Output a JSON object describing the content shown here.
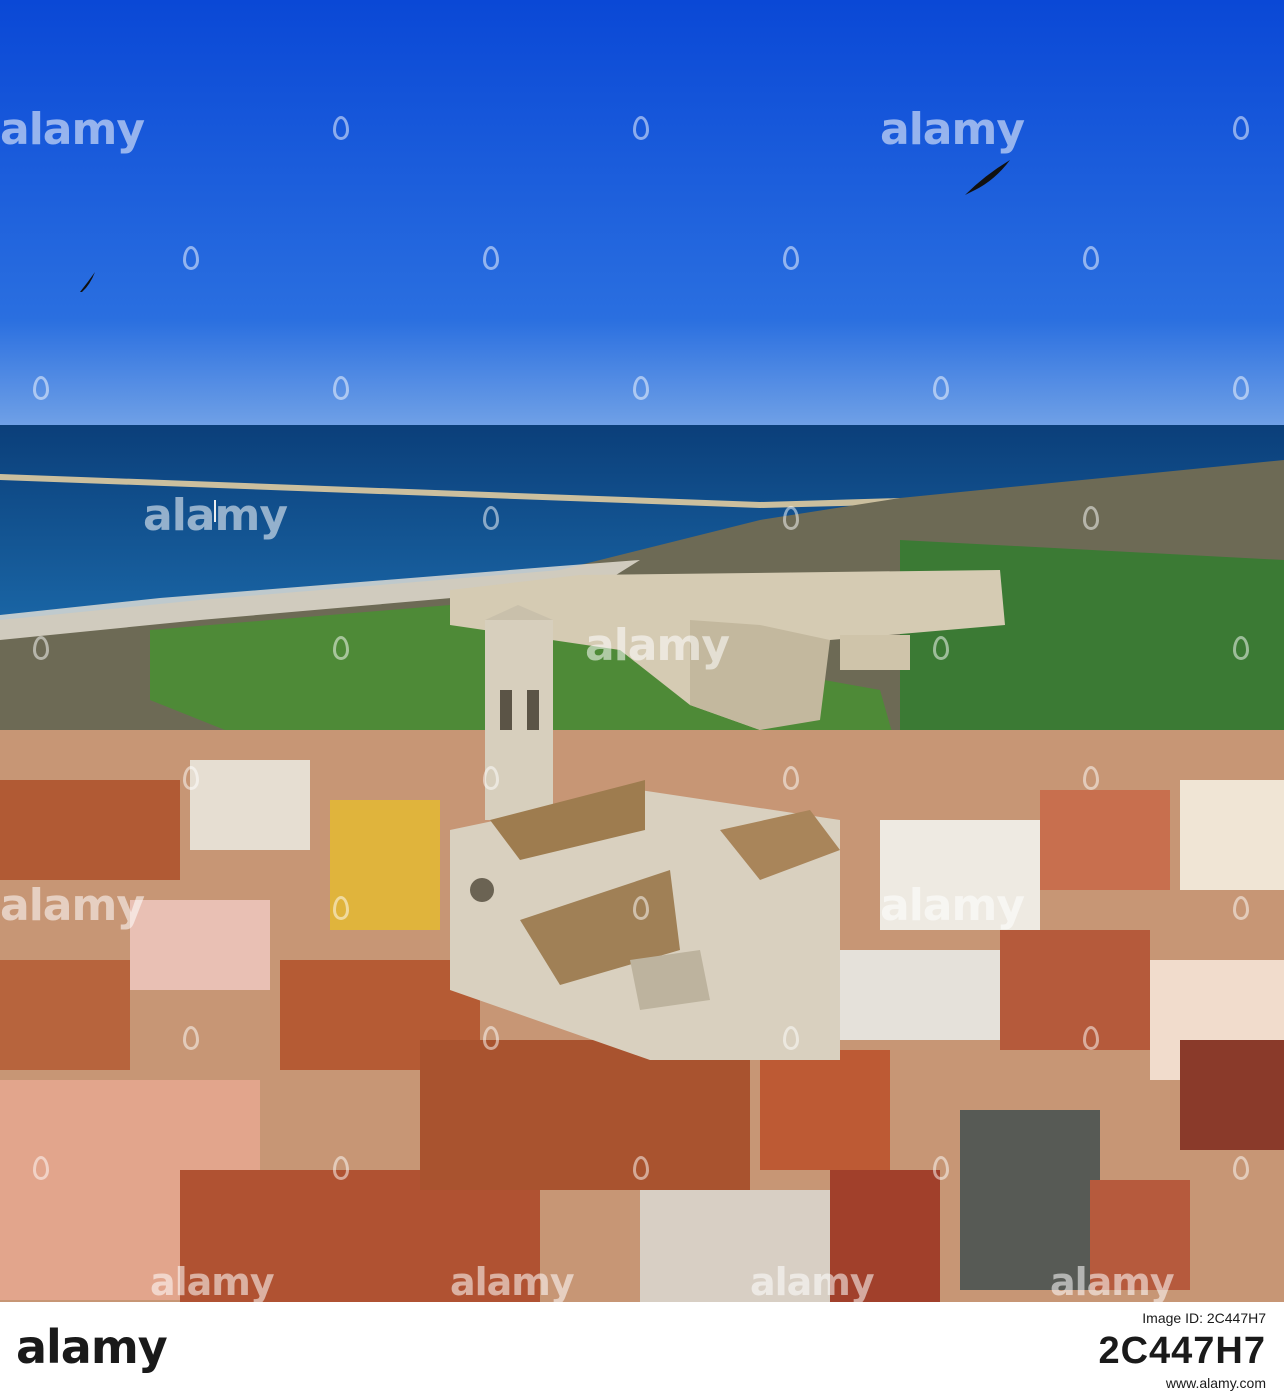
{
  "photo": {
    "subject": "aerial-view-coastal-town-cathedral-castle",
    "colors": {
      "sky": "#1552d8",
      "sea": "#0e4b86",
      "roofs": "#b5603a",
      "stone": "#d9d1bf",
      "trees": "#2f6e2c"
    }
  },
  "watermark": {
    "text": "alamy"
  },
  "footer": {
    "logo": "alamy",
    "image_id_label": "Image ID: 2C447H7",
    "image_id": "2C447H7",
    "url": "www.alamy.com"
  }
}
